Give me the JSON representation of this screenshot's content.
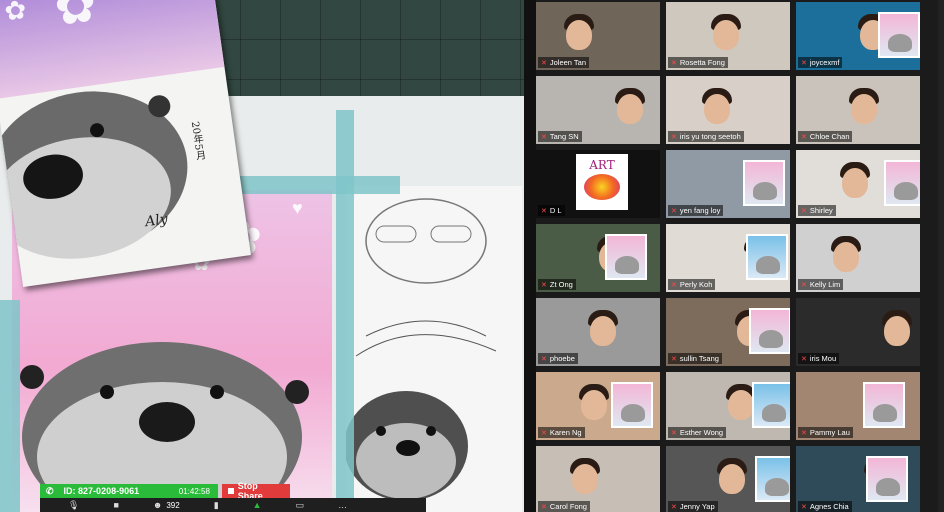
{
  "meeting": {
    "id_label": "ID: 827-0208-9061",
    "timer": "01:42:58",
    "stop_share_label": "Stop Share",
    "participant_count": "392"
  },
  "share": {
    "card_date": "20年5月",
    "signature": "Aly"
  },
  "participants": [
    {
      "name": "Joleen Tan"
    },
    {
      "name": "Rosetta Fong"
    },
    {
      "name": "joycexmf"
    },
    {
      "name": "Tang SN"
    },
    {
      "name": "iris yu tong seetoh"
    },
    {
      "name": "Chloe Chan"
    },
    {
      "name": "D L"
    },
    {
      "name": "yen fang loy"
    },
    {
      "name": "Shirley"
    },
    {
      "name": "Zt Ong"
    },
    {
      "name": "Perly Koh"
    },
    {
      "name": "Kelly Lim"
    },
    {
      "name": "phoebe"
    },
    {
      "name": "sullin Tsang"
    },
    {
      "name": "iris Mou"
    },
    {
      "name": "Karen Ng"
    },
    {
      "name": "Esther Wong"
    },
    {
      "name": "Pammy Lau"
    },
    {
      "name": "Carol Fong"
    },
    {
      "name": "Jenny Yap"
    },
    {
      "name": "Agnes Chia"
    }
  ],
  "art_logo": {
    "text": "ART"
  },
  "colors": {
    "id_green": "#2bbb3b",
    "stop_red": "#e13b3b",
    "mic_muted": "#ff4a4a"
  }
}
